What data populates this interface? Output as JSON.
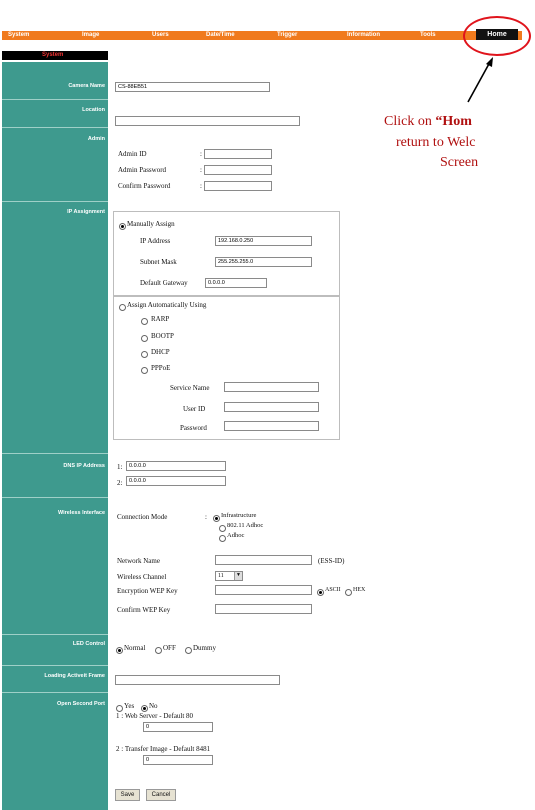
{
  "nav": {
    "items": [
      "System",
      "Image",
      "Users",
      "Date/Time",
      "Trigger",
      "Information",
      "Tools"
    ],
    "home": "Home"
  },
  "callout": {
    "line1a": "Click on ",
    "line1b": "“Hom",
    "line2": "return to Welc",
    "line3": "Screen"
  },
  "section": "System",
  "labels": {
    "camera_name": "Camera Name",
    "location": "Location",
    "admin": "Admin",
    "ip_assignment": "IP Assignment",
    "dns": "DNS IP Address",
    "wireless": "Wireless Interface",
    "led": "LED Control",
    "loading": "Loading Activeit Frame",
    "open_secondary": "Open Second Port"
  },
  "camera_name_value": "CS-88EB51",
  "location_value": "",
  "admin": {
    "id_label": "Admin ID",
    "password_label": "Admin Password",
    "confirm_label": "Confirm Password"
  },
  "ip": {
    "manual": "Manually Assign",
    "ip_label": "IP Address",
    "ip_value": "192.168.0.250",
    "mask_label": "Subnet Mask",
    "mask_value": "255.255.255.0",
    "gateway_label": "Default Gateway",
    "gateway_value": "0.0.0.0",
    "auto": "Assign Automatically Using",
    "rarp": "RARP",
    "bootp": "BOOTP",
    "dhcp": "DHCP",
    "pppoe": "PPPoE",
    "service_name": "Service Name",
    "user_id": "User ID",
    "password": "Password"
  },
  "dns": {
    "n1": "1:",
    "v1": "0.0.0.0",
    "n2": "2:",
    "v2": "0.0.0.0"
  },
  "wireless": {
    "mode_label": "Connection Mode",
    "infrastructure": "Infrastructure",
    "adhoc_80211": "802.11 Adhoc",
    "adhoc": "Adhoc",
    "network_label": "Network Name",
    "ssid": "(ESS-ID)",
    "channel_label": "Wireless Channel",
    "channel_value": "11",
    "wep_label": "Encryption WEP Key",
    "ascii": "ASCII",
    "hex": "HEX",
    "confirm_wep_label": "Confirm WEP Key"
  },
  "led": {
    "normal": "Normal",
    "off": "OFF",
    "dummy": "Dummy"
  },
  "port": {
    "yes": "Yes",
    "no": "No",
    "web_label": "1 : Web Server   - Default 80",
    "web_value": "0",
    "transfer_label": "2 : Transfer Image - Default 8481",
    "transfer_value": "0"
  },
  "buttons": {
    "save": "Save",
    "cancel": "Cancel"
  },
  "colors": {
    "nav": "#f07a1d",
    "label_column": "#3e9a8e",
    "callout": "#b01010",
    "highlight_circle": "#e0141c"
  }
}
